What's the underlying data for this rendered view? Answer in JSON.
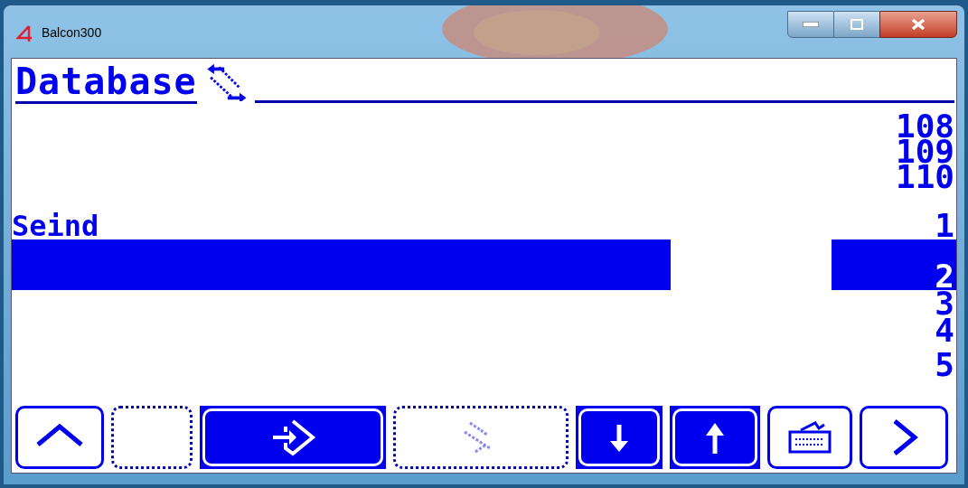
{
  "window": {
    "title": "Balcon300"
  },
  "header": {
    "title": "Database"
  },
  "list": {
    "rows": [
      {
        "number": "108",
        "selected": false
      },
      {
        "number": "109",
        "selected": false
      },
      {
        "number": "110",
        "selected": false
      },
      {
        "name": "Seind",
        "number": "1",
        "selected": false
      },
      {
        "number": "2",
        "selected": true
      },
      {
        "number": "3",
        "selected": false
      },
      {
        "number": "4",
        "selected": false
      },
      {
        "number": "5",
        "selected": false
      }
    ]
  },
  "toolbar": {
    "buttons": [
      {
        "kind": "up",
        "disabled": false,
        "active": false
      },
      {
        "kind": "blank",
        "disabled": true,
        "active": false
      },
      {
        "kind": "enter",
        "disabled": false,
        "active": true
      },
      {
        "kind": "swap",
        "disabled": true,
        "active": false
      },
      {
        "kind": "down",
        "disabled": false,
        "active": true
      },
      {
        "kind": "raise",
        "disabled": false,
        "active": true
      },
      {
        "kind": "keyboard",
        "disabled": false,
        "active": false
      },
      {
        "kind": "next",
        "disabled": false,
        "active": false
      }
    ]
  }
}
